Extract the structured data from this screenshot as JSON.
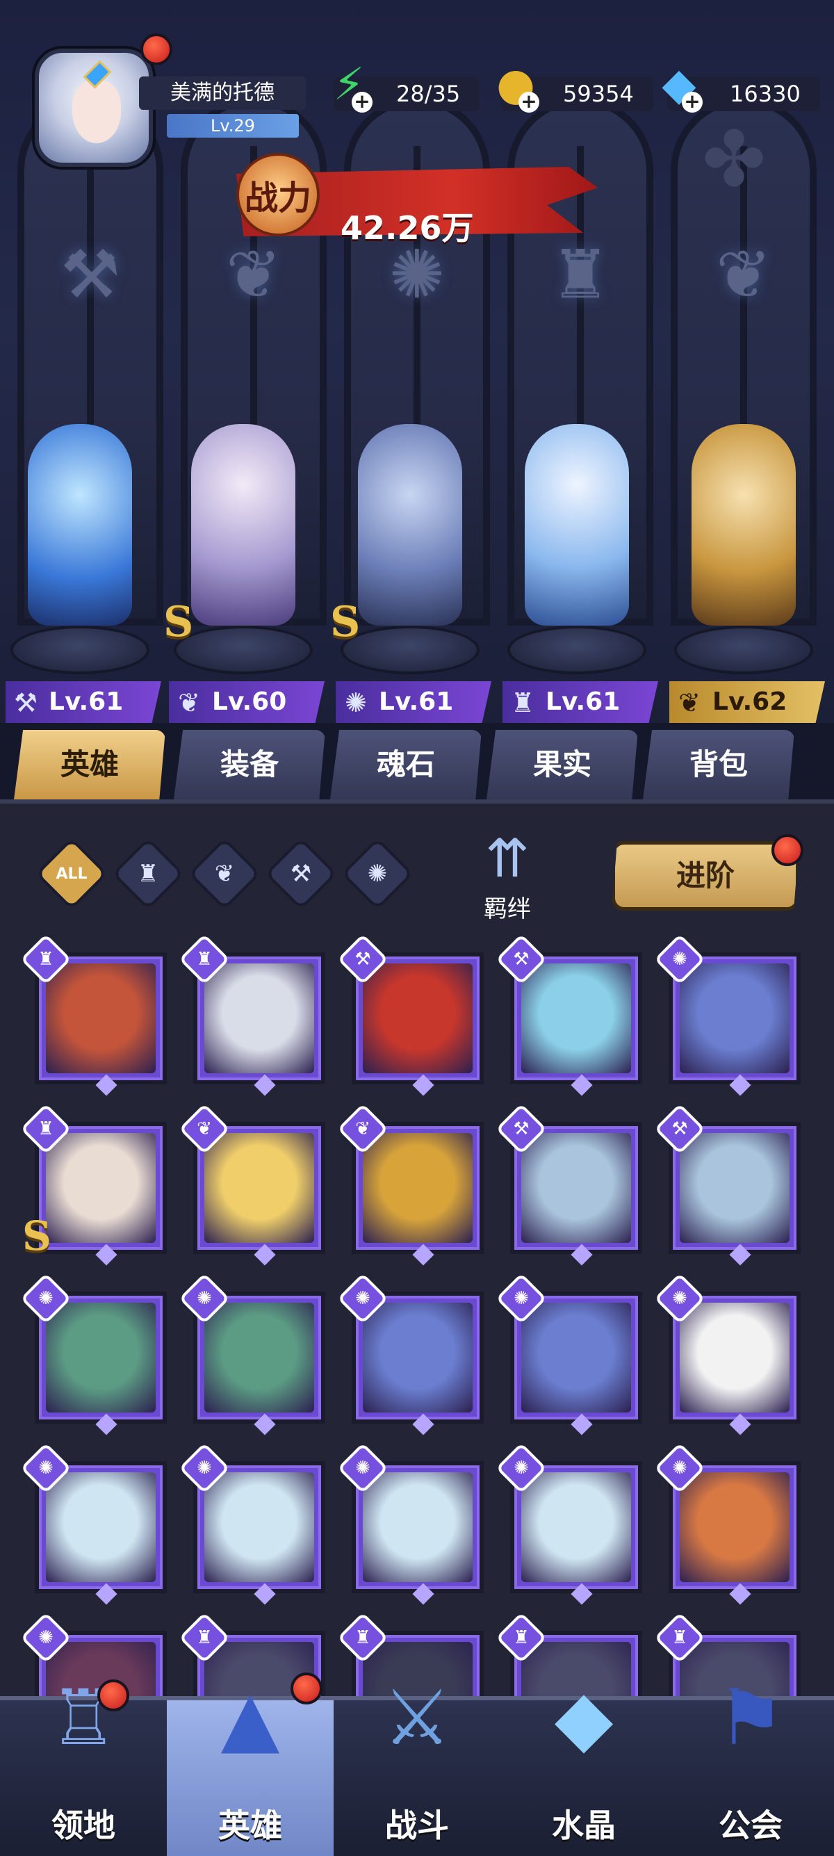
{
  "profile": {
    "name": "美满的托德",
    "level": "Lv.29"
  },
  "resources": {
    "stamina": {
      "value": "28/35",
      "icon": "lightning-icon",
      "color": "#3fd46a"
    },
    "gold": {
      "value": "59354",
      "icon": "gold-coin-icon",
      "color": "#e6b52c"
    },
    "diamond": {
      "value": "16330",
      "icon": "diamond-icon",
      "color": "#56b8ff"
    }
  },
  "power": {
    "label": "战力",
    "value": "42.26万"
  },
  "team": [
    {
      "level": "Lv.61",
      "class_icon": "wrench-icon",
      "color": "#58a6ff",
      "s_rank": false
    },
    {
      "level": "Lv.60",
      "class_icon": "wing-icon",
      "color": "#c8b8e8",
      "s_rank": true
    },
    {
      "level": "Lv.61",
      "class_icon": "claw-icon",
      "color": "#7c93c8",
      "s_rank": true
    },
    {
      "level": "Lv.61",
      "class_icon": "tower-icon",
      "color": "#8cc4ff",
      "s_rank": false
    },
    {
      "level": "Lv.62",
      "class_icon": "wing-icon",
      "color": "#e9c27a",
      "s_rank": false,
      "gold": true
    }
  ],
  "tabs": [
    {
      "label": "英雄",
      "active": true
    },
    {
      "label": "装备",
      "active": false
    },
    {
      "label": "魂石",
      "active": false
    },
    {
      "label": "果实",
      "active": false
    },
    {
      "label": "背包",
      "active": false
    }
  ],
  "filters": {
    "all_label": "ALL",
    "icons": [
      "tower-icon",
      "wing-icon",
      "wrench-icon",
      "claw-icon"
    ],
    "bond_label": "羁绊",
    "advance_label": "进阶"
  },
  "hero_grid": [
    [
      {
        "class_icon": "tower-icon",
        "portrait": "wizard-hat",
        "color": "#c4553a",
        "s_rank": false
      },
      {
        "class_icon": "tower-icon",
        "portrait": "silver-queen",
        "color": "#d9dde8",
        "s_rank": false
      },
      {
        "class_icon": "wrench-icon",
        "portrait": "red-robot",
        "color": "#c7372c",
        "s_rank": false
      },
      {
        "class_icon": "wrench-icon",
        "portrait": "crystal-pod",
        "color": "#8bd0e8",
        "s_rank": false
      },
      {
        "class_icon": "claw-icon",
        "portrait": "ice-beast",
        "color": "#6b7ed0",
        "s_rank": false
      }
    ],
    [
      {
        "class_icon": "tower-icon",
        "portrait": "horned-priestess",
        "color": "#e9dcd3",
        "s_rank": true
      },
      {
        "class_icon": "wing-icon",
        "portrait": "blonde-paladin",
        "color": "#f0cf6a",
        "s_rank": false
      },
      {
        "class_icon": "wing-icon",
        "portrait": "pharaoh",
        "color": "#d8a43a",
        "s_rank": false
      },
      {
        "class_icon": "wrench-icon",
        "portrait": "mech-cube",
        "color": "#a9c4dc",
        "s_rank": false
      },
      {
        "class_icon": "wrench-icon",
        "portrait": "mech-cube",
        "color": "#a9c4dc",
        "s_rank": false
      }
    ],
    [
      {
        "class_icon": "claw-icon",
        "portrait": "naga-queen",
        "color": "#5c9c84",
        "s_rank": false
      },
      {
        "class_icon": "claw-icon",
        "portrait": "naga-queen",
        "color": "#5c9c84",
        "s_rank": false
      },
      {
        "class_icon": "claw-icon",
        "portrait": "ice-beast",
        "color": "#6b7ed0",
        "s_rank": false
      },
      {
        "class_icon": "claw-icon",
        "portrait": "ice-beast",
        "color": "#6b7ed0",
        "s_rank": false
      },
      {
        "class_icon": "claw-icon",
        "portrait": "panda-monk",
        "color": "#f2f2f2",
        "s_rank": false
      }
    ],
    [
      {
        "class_icon": "claw-icon",
        "portrait": "white-tiger",
        "color": "#cfe6f2",
        "s_rank": false
      },
      {
        "class_icon": "claw-icon",
        "portrait": "white-tiger",
        "color": "#cfe6f2",
        "s_rank": false
      },
      {
        "class_icon": "claw-icon",
        "portrait": "white-tiger",
        "color": "#cfe6f2",
        "s_rank": false
      },
      {
        "class_icon": "claw-icon",
        "portrait": "white-tiger",
        "color": "#cfe6f2",
        "s_rank": false
      },
      {
        "class_icon": "claw-icon",
        "portrait": "fox-warrior",
        "color": "#d87944",
        "s_rank": false
      }
    ],
    [
      {
        "class_icon": "claw-icon",
        "portrait": "partial",
        "color": "#6a3a5a",
        "s_rank": false
      },
      {
        "class_icon": "tower-icon",
        "portrait": "partial",
        "color": "#4a4a6a",
        "s_rank": false
      },
      {
        "class_icon": "tower-icon",
        "portrait": "partial",
        "color": "#3a3c55",
        "s_rank": false
      },
      {
        "class_icon": "tower-icon",
        "portrait": "partial",
        "color": "#4a4a6a",
        "s_rank": false
      },
      {
        "class_icon": "tower-icon",
        "portrait": "partial",
        "color": "#4a4a6a",
        "s_rank": false
      }
    ]
  ],
  "nav": [
    {
      "label": "领地",
      "icon": "castle-icon",
      "active": false,
      "badge": true
    },
    {
      "label": "英雄",
      "icon": "wizard-hat-icon",
      "active": true,
      "badge": true
    },
    {
      "label": "战斗",
      "icon": "battle-icon",
      "active": false,
      "badge": false
    },
    {
      "label": "水晶",
      "icon": "crystal-icon",
      "active": false,
      "badge": false
    },
    {
      "label": "公会",
      "icon": "banner-icon",
      "active": false,
      "badge": false
    }
  ]
}
